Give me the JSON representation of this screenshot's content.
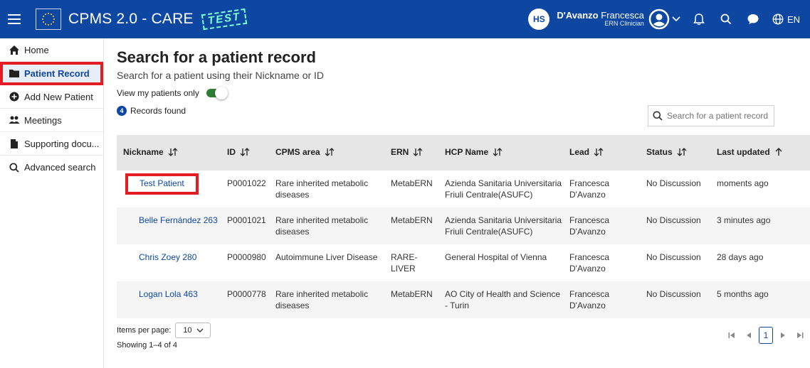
{
  "header": {
    "title": "CPMS 2.0 - CARE",
    "test_stamp": "TEST",
    "initials": "HS",
    "user_last_name": "D'Avanzo",
    "user_first_name": "Francesca",
    "user_role": "ERN Clinician",
    "language": "EN",
    "accent_color": "#0e47a1"
  },
  "sidebar": {
    "items": [
      {
        "label": "Home",
        "icon": "home-icon"
      },
      {
        "label": "Patient Record",
        "icon": "folder-icon"
      },
      {
        "label": "Add New Patient",
        "icon": "plus-circle-icon"
      },
      {
        "label": "Meetings",
        "icon": "people-icon"
      },
      {
        "label": "Supporting docu...",
        "icon": "document-icon"
      },
      {
        "label": "Advanced search",
        "icon": "search-icon"
      }
    ]
  },
  "main": {
    "title": "Search for a patient record",
    "subtitle": "Search for a patient using their Nickname or ID",
    "toggle_label": "View my patients only",
    "records_count": "4",
    "records_label": "Records found",
    "search_placeholder": "Search for a patient record"
  },
  "table": {
    "columns": [
      "Nickname",
      "ID",
      "CPMS area",
      "ERN",
      "HCP Name",
      "Lead",
      "Status",
      "Last updated"
    ],
    "rows": [
      {
        "nickname": "Test Patient",
        "id": "P0001022",
        "area": "Rare inherited metabolic diseases",
        "ern": "MetabERN",
        "hcp": "Azienda Sanitaria Universitaria Friuli Centrale(ASUFC)",
        "lead": "Francesca D'Avanzo",
        "status": "No Discussion",
        "updated": "moments ago"
      },
      {
        "nickname": "Belle Fernández 263",
        "id": "P0001021",
        "area": "Rare inherited metabolic diseases",
        "ern": "MetabERN",
        "hcp": "Azienda Sanitaria Universitaria Friuli Centrale(ASUFC)",
        "lead": "Francesca D'Avanzo",
        "status": "No Discussion",
        "updated": "3 minutes ago"
      },
      {
        "nickname": "Chris Zoey 280",
        "id": "P0000980",
        "area": "Autoimmune Liver Disease",
        "ern": "RARE-LIVER",
        "hcp": "General Hospital of Vienna",
        "lead": "Francesca D'Avanzo",
        "status": "No Discussion",
        "updated": "28 days ago"
      },
      {
        "nickname": "Logan Lola 463",
        "id": "P0000778",
        "area": "Rare inherited metabolic diseases",
        "ern": "MetabERN",
        "hcp": "AO City of Health and Science - Turin",
        "lead": "Francesca D'Avanzo",
        "status": "No Discussion",
        "updated": "5 months ago"
      }
    ]
  },
  "footer": {
    "items_per_page_label": "Items per page:",
    "items_per_page_value": "10",
    "showing": "Showing 1–4 of 4",
    "current_page": "1"
  }
}
